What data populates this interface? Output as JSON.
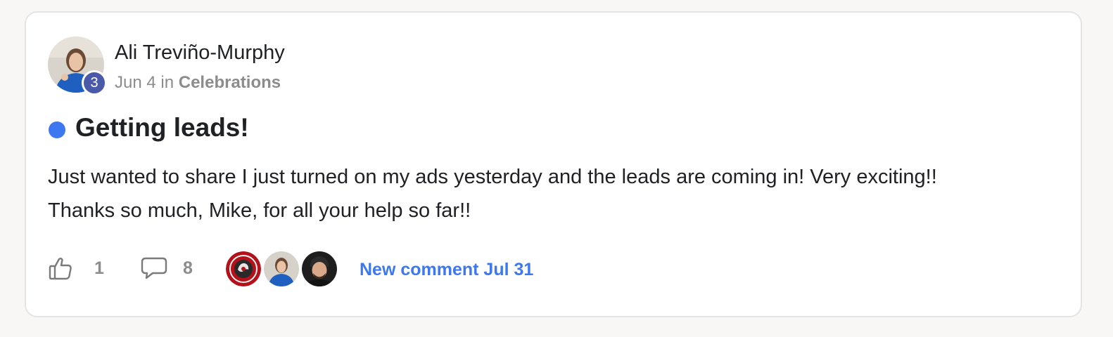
{
  "post": {
    "author": {
      "name": "Ali Treviño-Murphy",
      "level": "3",
      "avatar_icon": "person-avatar-icon"
    },
    "meta": {
      "date": "Jun 4",
      "preposition": "in",
      "category": "Celebrations"
    },
    "title": "Getting leads!",
    "unread_color": "#3d78f0",
    "body": [
      "Just wanted to share I just turned on my ads yesterday and the leads are coming in! Very exciting!!",
      "Thanks so much, Mike, for all your help so far!!"
    ],
    "likes": {
      "icon": "thumbs-up-icon",
      "count": "1"
    },
    "comments": {
      "icon": "comment-bubble-icon",
      "count": "8"
    },
    "participants": [
      {
        "avatar": "red-logo-avatar"
      },
      {
        "avatar": "woman-blue-shirt-avatar"
      },
      {
        "avatar": "bald-man-avatar"
      }
    ],
    "last_activity": "New comment Jul 31"
  },
  "colors": {
    "accent": "#3d78f0",
    "level_badge": "#4a5aa8",
    "muted_text": "#8c8c8c"
  }
}
